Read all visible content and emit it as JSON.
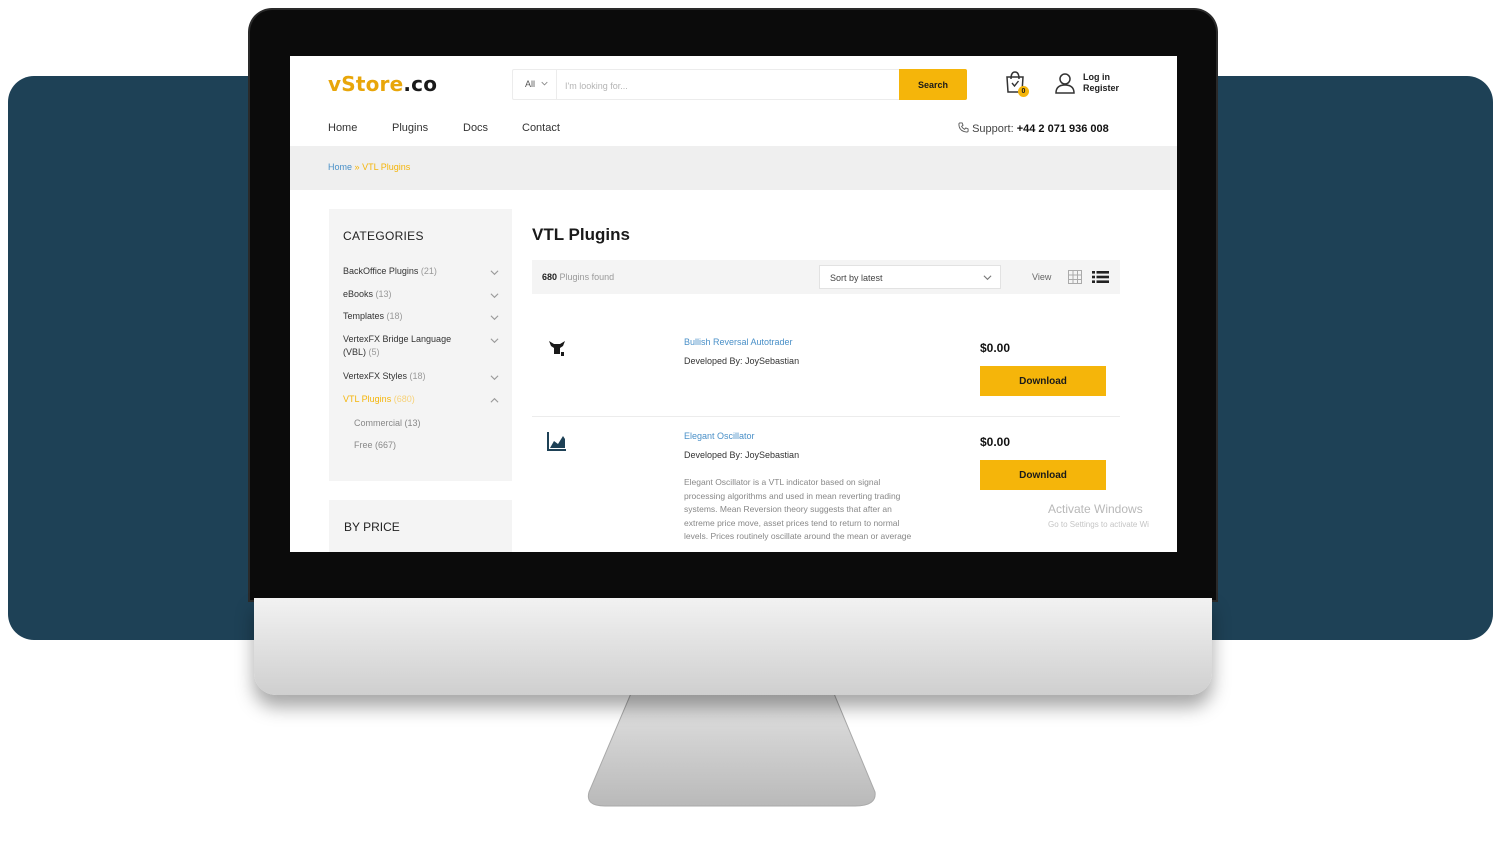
{
  "header": {
    "logo_main": "vStore",
    "logo_suffix": ".co",
    "category_select": "All",
    "search_placeholder": "I'm looking for...",
    "search_button": "Search",
    "cart_count": "0",
    "login_label": "Log in",
    "register_label": "Register",
    "icons": [
      "chevron-down-icon",
      "shopping-bag-icon",
      "user-icon"
    ]
  },
  "nav": {
    "items": [
      "Home",
      "Plugins",
      "Docs",
      "Contact"
    ],
    "support_label": "Support:",
    "support_phone": "+44 2 071 936 008"
  },
  "breadcrumb": {
    "home": "Home",
    "separator": "»",
    "current": "VTL Plugins"
  },
  "sidebar": {
    "categories_title": "CATEGORIES",
    "categories": [
      {
        "label": "BackOffice Plugins",
        "count": "(21)"
      },
      {
        "label": "eBooks",
        "count": "(13)"
      },
      {
        "label": "Templates",
        "count": "(18)"
      },
      {
        "label": "VertexFX Bridge Language (VBL)",
        "count": "(5)"
      },
      {
        "label": "VertexFX Styles",
        "count": "(18)"
      },
      {
        "label": "VTL Plugins",
        "count": "(680)"
      }
    ],
    "subcategories": [
      {
        "label": "Commercial",
        "count": "(13)"
      },
      {
        "label": "Free",
        "count": "(667)"
      }
    ],
    "price_title": "BY PRICE"
  },
  "main": {
    "title": "VTL Plugins",
    "found_count": "680",
    "found_label": "Plugins found",
    "sort_value": "Sort by latest",
    "view_label": "View",
    "products": [
      {
        "name": "Bullish Reversal Autotrader",
        "developer": "Developed By: JoySebastian",
        "price": "$0.00",
        "button": "Download",
        "icon": "robot-icon"
      },
      {
        "name": "Elegant Oscillator",
        "developer": "Developed By: JoySebastian",
        "price": "$0.00",
        "button": "Download",
        "icon": "area-chart-icon",
        "description": "Elegant Oscillator is a VTL indicator based on signal processing algorithms and used in mean reverting trading systems. Mean Reversion theory suggests that after an extreme price move, asset prices tend to return to normal levels. Prices routinely oscillate around the mean or average"
      }
    ]
  },
  "os_watermark": {
    "title": "Activate Windows",
    "subtitle": "Go to Settings to activate Wi"
  },
  "colors": {
    "accent": "#f5b50a",
    "link": "#4a90c8",
    "backdrop": "#1e4156"
  }
}
